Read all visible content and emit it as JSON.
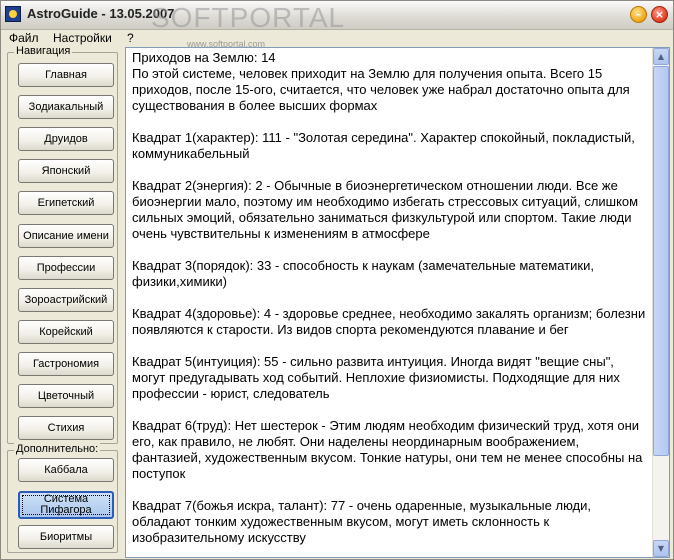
{
  "window": {
    "title": "AstroGuide - 13.05.2007",
    "watermark": "SOFTPORTAL",
    "watermark_url": "www.softportal.com",
    "controls": {
      "minimize": "–",
      "close": "×"
    }
  },
  "menu": [
    "Файл",
    "Настройки",
    "?"
  ],
  "sidebar": {
    "navigation_label": "Навигация",
    "navigation_items": [
      "Главная",
      "Зодиакальный",
      "Друидов",
      "Японский",
      "Египетский",
      "Описание имени",
      "Профессии",
      "Зороастрийский",
      "Корейский",
      "Гастрономия",
      "Цветочный",
      "Стихия"
    ],
    "extra_label": "Дополнительно:",
    "extra_items": [
      "Каббала",
      "Система Пифагора",
      "Биоритмы"
    ],
    "active_item": "Система Пифагора"
  },
  "content": {
    "paragraphs": [
      "Приходов на Землю: 14\nПо этой системе, человек приходит на Землю для получения опыта. Всего 15 приходов, после 15-ого, считается, что человек уже набрал достаточно опыта для существования в более высших формах",
      "Квадрат 1(характер): 111 - \"Золотая середина\". Характер спокойный, покладистый, коммуникабельный",
      "Квадрат 2(энергия): 2 - Обычные в биоэнергетическом отношении люди. Все же биоэнергии мало, поэтому им необходимо избегать стрессовых ситуаций, слишком сильных эмоций, обязательно заниматься физкультурой или спортом. Такие люди очень чувствительны к изменениям в атмосфере",
      "Квадрат 3(порядок): 33 - способность к наукам (замечательные математики, физики,химики)",
      "Квадрат 4(здоровье): 4 - здоровье среднее, необходимо закалять организм; болезни появляются к старости. Из видов спорта рекомендуются плавание и бег",
      "Квадрат 5(интуиция): 55 - сильно развита интуиция. Иногда видят \"вещие сны\", могут предугадывать ход событий. Неплохие физиомисты. Подходящие для них профессии - юрист, следователь",
      "Квадрат 6(труд): Нет шестерок - Этим людям необходим физический труд, хотя они его, как правило, не любят. Они наделены неординарным воображением, фантазией, художественным вкусом. Тонкие натуры, они тем не менее способны на поступок",
      "Квадрат 7(божья искра, талант): 77 - очень одаренные, музыкальные люди, обладают тонким художественным вкусом, могут иметь склонность к изобразительному искусству"
    ]
  }
}
